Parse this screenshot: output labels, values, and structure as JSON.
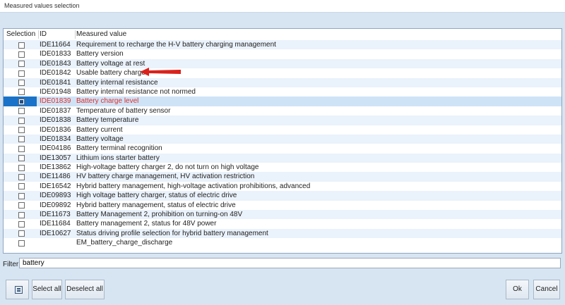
{
  "window": {
    "title": "Measured values selection"
  },
  "table": {
    "headers": {
      "selection": "Selection",
      "id": "ID",
      "measured_value": "Measured value"
    },
    "rows": [
      {
        "id": "IDE11664",
        "label": "Requirement to recharge the H-V battery charging management",
        "checked": false,
        "selected": false
      },
      {
        "id": "IDE01833",
        "label": "Battery version",
        "checked": false,
        "selected": false
      },
      {
        "id": "IDE01843",
        "label": "Battery voltage at rest",
        "checked": false,
        "selected": false
      },
      {
        "id": "IDE01842",
        "label": "Usable battery charge",
        "checked": false,
        "selected": false
      },
      {
        "id": "IDE01841",
        "label": "Battery internal resistance",
        "checked": false,
        "selected": false
      },
      {
        "id": "IDE01948",
        "label": "Battery internal resistance not normed",
        "checked": false,
        "selected": false
      },
      {
        "id": "IDE01839",
        "label": "Battery charge level",
        "checked": true,
        "selected": true
      },
      {
        "id": "IDE01837",
        "label": "Temperature of battery sensor",
        "checked": false,
        "selected": false
      },
      {
        "id": "IDE01838",
        "label": "Battery temperature",
        "checked": false,
        "selected": false
      },
      {
        "id": "IDE01836",
        "label": "Battery current",
        "checked": false,
        "selected": false
      },
      {
        "id": "IDE01834",
        "label": "Battery voltage",
        "checked": false,
        "selected": false
      },
      {
        "id": "IDE04186",
        "label": "Battery terminal recognition",
        "checked": false,
        "selected": false
      },
      {
        "id": "IDE13057",
        "label": "Lithium ions starter battery",
        "checked": false,
        "selected": false
      },
      {
        "id": "IDE13862",
        "label": "High-voltage battery charger 2, do not turn on high voltage",
        "checked": false,
        "selected": false
      },
      {
        "id": "IDE11486",
        "label": "HV battery charge management, HV activation restriction",
        "checked": false,
        "selected": false
      },
      {
        "id": "IDE16542",
        "label": "Hybrid battery management, high-voltage activation prohibitions, advanced",
        "checked": false,
        "selected": false
      },
      {
        "id": "IDE09893",
        "label": "High voltage battery charger, status of electric drive",
        "checked": false,
        "selected": false
      },
      {
        "id": "IDE09892",
        "label": "Hybrid battery management, status of electric drive",
        "checked": false,
        "selected": false
      },
      {
        "id": "IDE11673",
        "label": "Battery Management 2, prohibition on turning-on 48V",
        "checked": false,
        "selected": false
      },
      {
        "id": "IDE11684",
        "label": "Battery management 2, status for 48V power",
        "checked": false,
        "selected": false
      },
      {
        "id": "IDE10627",
        "label": "Status driving profile selection for hybrid battery management",
        "checked": false,
        "selected": false
      },
      {
        "id": "",
        "label": "EM_battery_charge_discharge",
        "checked": false,
        "selected": false
      }
    ]
  },
  "filter": {
    "label": "Filter:",
    "value": "battery"
  },
  "buttons": {
    "select_all": "Select all",
    "deselect_all": "Deselect all",
    "ok": "Ok",
    "cancel": "Cancel"
  },
  "colors": {
    "selected_text": "#e0302c",
    "annotation_arrow": "#d9221c",
    "selection_highlight": "#1a73c8"
  },
  "icons": {
    "toolbar_icon": "list-icon",
    "annotation": "arrow-left-icon"
  }
}
